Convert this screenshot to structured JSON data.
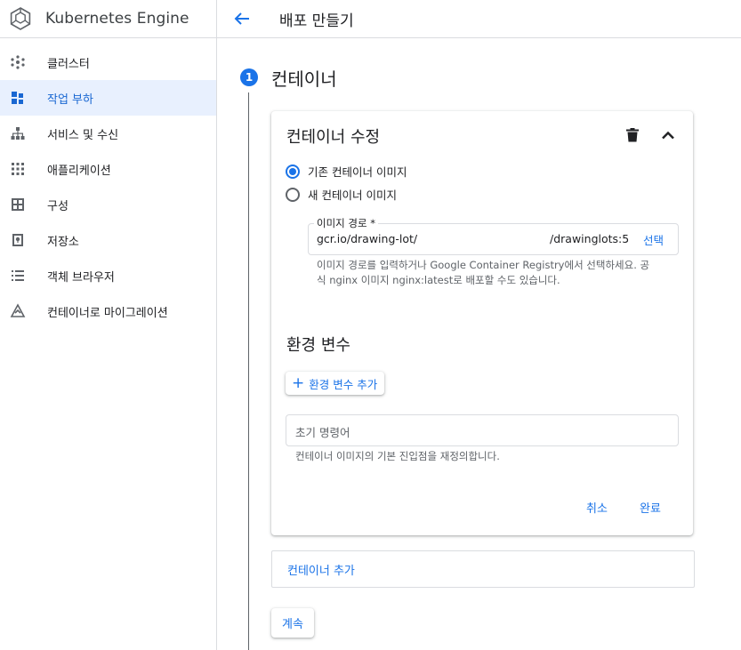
{
  "colors": {
    "accent": "#1a73e8",
    "active_bg": "#e8f0fe",
    "border": "#dadce0",
    "text": "#202124",
    "muted": "#5f6368"
  },
  "sidebar": {
    "title": "Kubernetes Engine",
    "items": [
      {
        "label": "클러스터",
        "icon": "clusters-icon",
        "active": false
      },
      {
        "label": "작업 부하",
        "icon": "workloads-icon",
        "active": true
      },
      {
        "label": "서비스 및 수신",
        "icon": "services-icon",
        "active": false
      },
      {
        "label": "애플리케이션",
        "icon": "applications-icon",
        "active": false
      },
      {
        "label": "구성",
        "icon": "configuration-icon",
        "active": false
      },
      {
        "label": "저장소",
        "icon": "storage-icon",
        "active": false
      },
      {
        "label": "객체 브라우저",
        "icon": "object-browser-icon",
        "active": false
      },
      {
        "label": "컨테이너로 마이그레이션",
        "icon": "migrate-icon",
        "active": false
      }
    ]
  },
  "header": {
    "title": "배포 만들기"
  },
  "step": {
    "number": "1",
    "title": "컨테이너"
  },
  "card": {
    "title": "컨테이너 수정",
    "radio_existing": "기존 컨테이너 이미지",
    "radio_new": "새 컨테이너 이미지",
    "image_path_label": "이미지 경로 *",
    "image_path_value": "gcr.io/drawing-lot/",
    "image_path_suffix": "/drawinglots:5",
    "select_label": "선택",
    "image_hint_line1": "이미지 경로를 입력하거나 Google Container Registry에서 선택하세요. 공",
    "image_hint_line2": "식 nginx 이미지 nginx:latest로 배포할 수도 있습니다.",
    "env_title": "환경 변수",
    "add_env_label": "환경 변수 추가",
    "command_placeholder": "초기 명령어",
    "command_hint": "컨테이너 이미지의 기본 진입점을 재정의합니다.",
    "cancel_label": "취소",
    "done_label": "완료"
  },
  "add_container_label": "컨테이너 추가",
  "continue_label": "계속"
}
